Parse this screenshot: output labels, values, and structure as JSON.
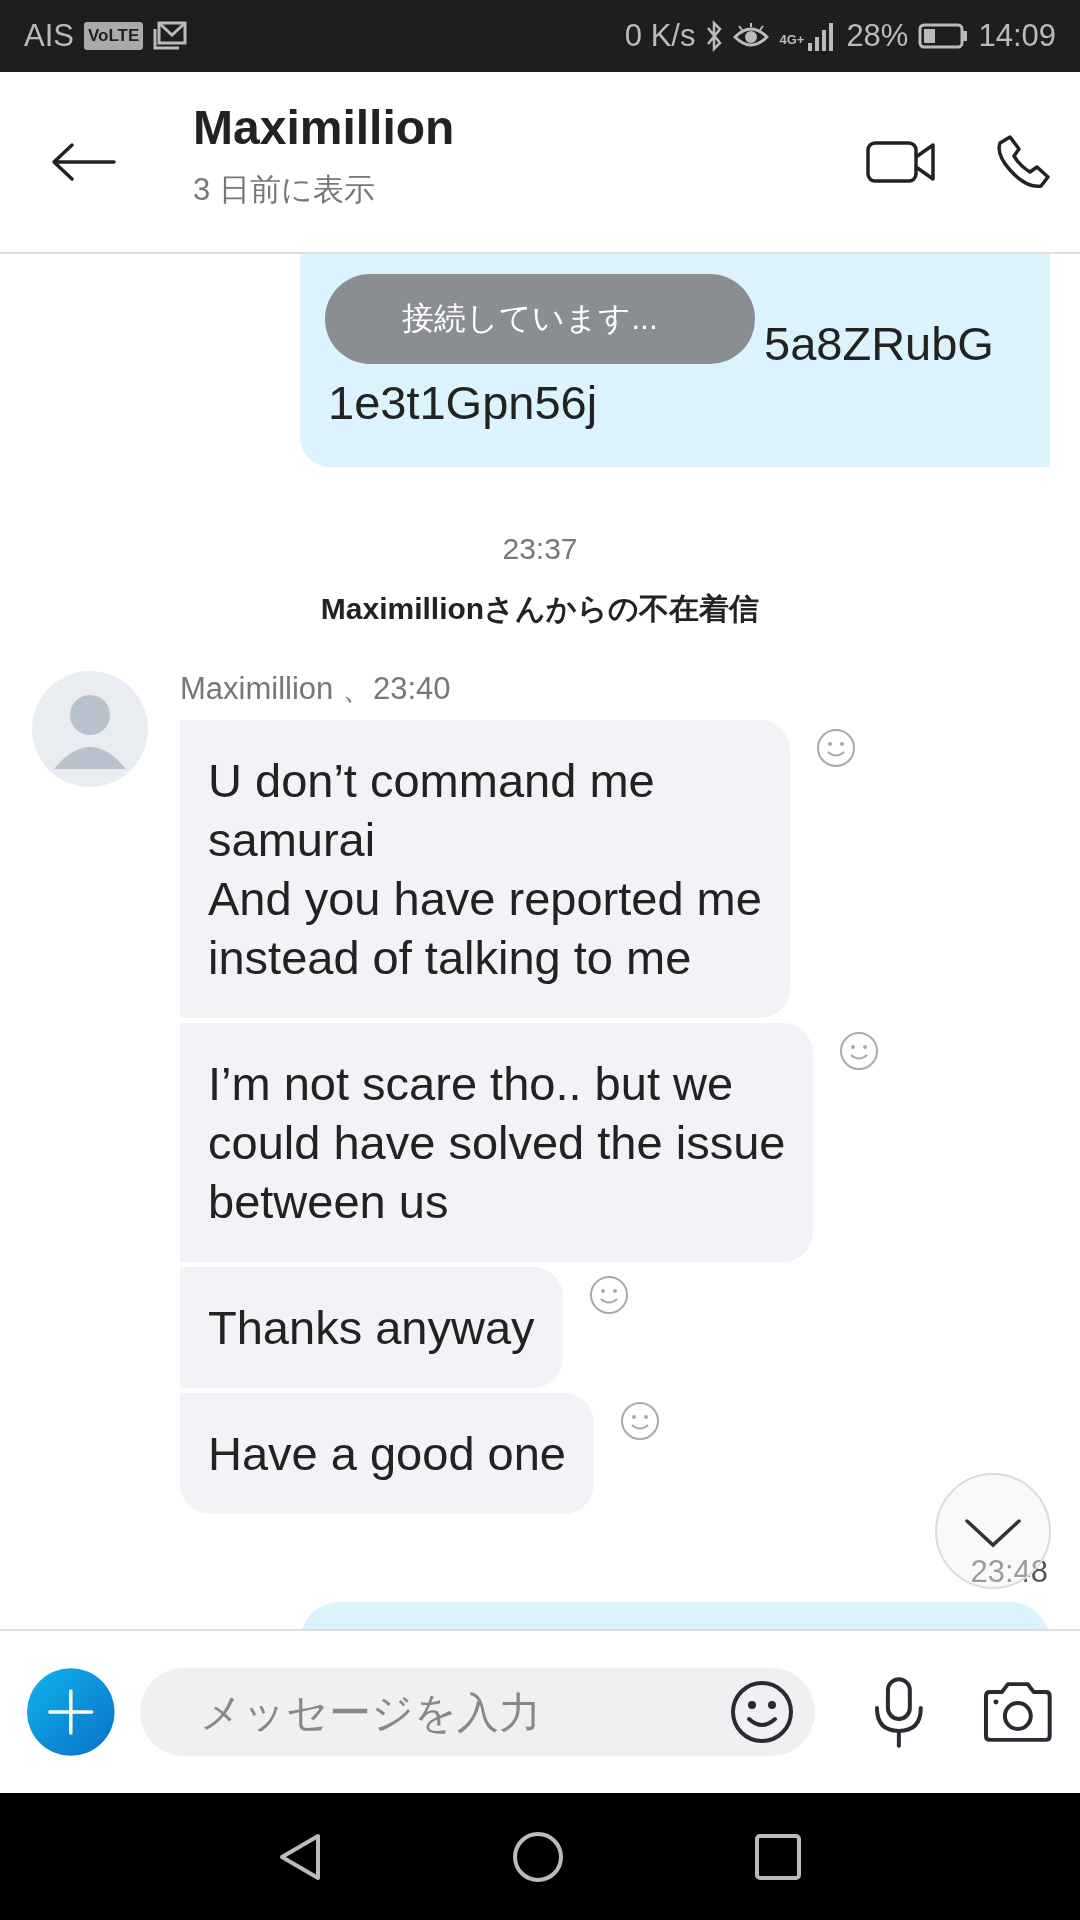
{
  "status_bar": {
    "carrier": "AIS",
    "volte": "VoLTE",
    "speed": "0 K/s",
    "network": "4G+",
    "battery": "28%",
    "clock": "14:09"
  },
  "header": {
    "title": "Maximillion",
    "subtitle": "3 日前に表示"
  },
  "toast": "接続しています...",
  "messages": [
    {
      "kind": "outgoing",
      "covered_line": "5a8ZRubG",
      "text": "1e3t1Gpn56j"
    },
    {
      "kind": "time",
      "text": "23:37"
    },
    {
      "kind": "event",
      "text": "Maximillionさんからの不在着信"
    },
    {
      "kind": "incoming_group",
      "sender": "Maximillion 、23:40",
      "bubbles": [
        "U don’t command me\nsamurai\nAnd you have reported me\ninstead of talking to me",
        "I’m not scare tho.. but we\ncould have solved the issue\nbetween us",
        "Thanks anyway",
        "Have a good one"
      ]
    },
    {
      "kind": "own_time",
      "text": "23:48"
    },
    {
      "kind": "outgoing_edge"
    }
  ],
  "composer": {
    "placeholder": "メッセージを入力"
  }
}
